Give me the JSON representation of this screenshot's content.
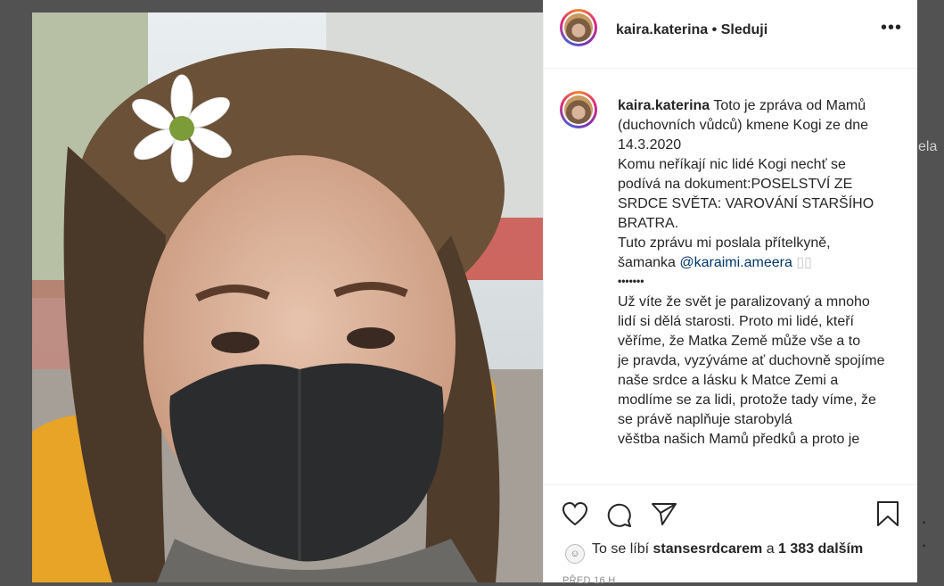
{
  "background": {
    "peek_text": "ela",
    "peek_dots": "· ·"
  },
  "post": {
    "image_alt": "selfie of a woman with dreadlocks, a white daisy in her hair and a black face mask",
    "header": {
      "username": "kaira.katerina",
      "separator": "•",
      "follow_label": "Sleduji",
      "more_icon": "more-horizontal-icon",
      "more_label": "•••"
    },
    "caption": {
      "username": "kaira.katerina",
      "paragraphs": [
        "Toto je zpráva od Mamů (duchovních vůdců) kmene Kogi ze dne 14.3.2020",
        "Komu neříkají nic lidé Kogi nechť se podívá na dokument:POSELSTVÍ ZE SRDCE SVĚTA: VAROVÁNÍ STARŠÍHO BRATRA.",
        "Tuto zprávu mi poslala přítelkyně, šamanka"
      ],
      "mention": "@karaimi.ameera",
      "mention_suffix": "▯▯",
      "dots": "•••••••",
      "paragraphs_after": [
        "Už víte že svět je paralizovaný a mnoho lidí si dělá starosti. Proto mi lidé, kteří věříme, že Matka Země může vše a to",
        "je pravda, vyzýváme ať duchovně spojíme naše srdce a lásku k Matce Zemi a modlíme se za lidi, protože tady víme, že se právě naplňuje starobylá",
        "věštba našich Mamů předků a proto je"
      ]
    },
    "actions": {
      "like_icon": "heart-icon",
      "comment_icon": "comment-icon",
      "share_icon": "paper-plane-icon",
      "save_icon": "bookmark-icon"
    },
    "likes": {
      "prefix": "To se líbí",
      "user": "stansesrdcarem",
      "conjunction": "a",
      "others": "1 383 dalším"
    },
    "timestamp": "PŘED 16 H"
  }
}
